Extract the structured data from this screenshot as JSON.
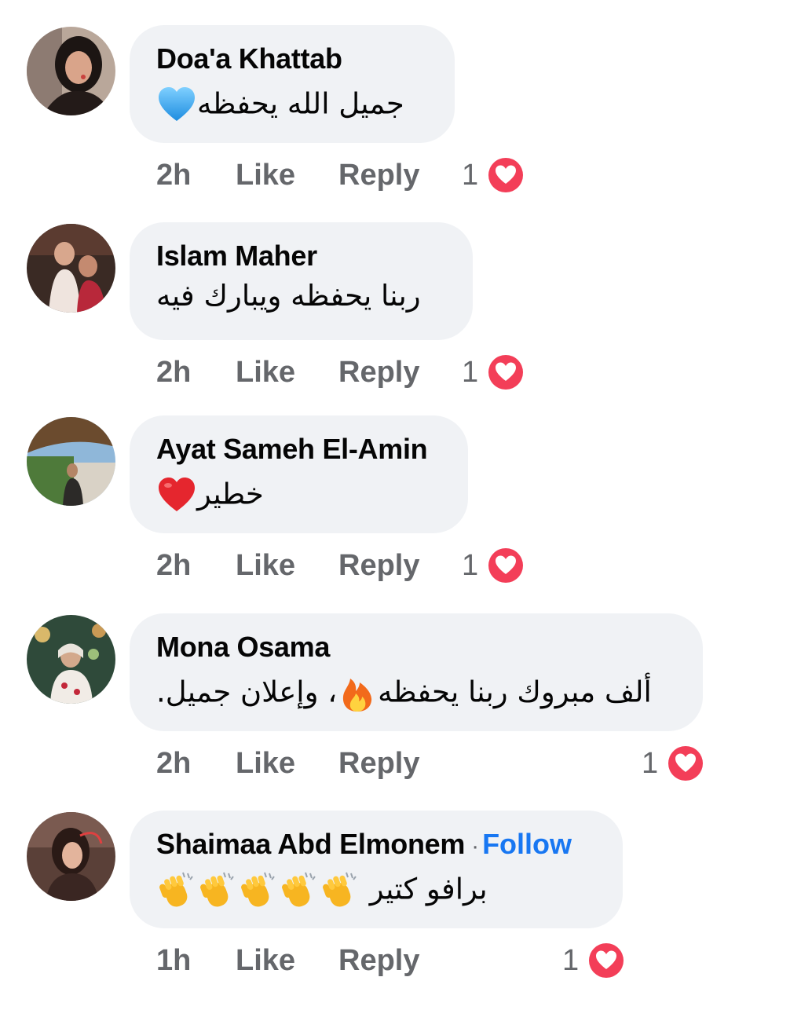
{
  "comments": [
    {
      "author": "Doa'a Khattab",
      "text": "جميل الله يحفظه",
      "emoji": "blue-heart-emoji",
      "time": "2h",
      "like_label": "Like",
      "reply_label": "Reply",
      "reaction_count": "1",
      "reaction_icon": "love-reaction-icon"
    },
    {
      "author": "Islam Maher",
      "text": "ربنا يحفظه ويبارك فيه",
      "time": "2h",
      "like_label": "Like",
      "reply_label": "Reply",
      "reaction_count": "1",
      "reaction_icon": "love-reaction-icon"
    },
    {
      "author": "Ayat Sameh El-Amin",
      "text": "خطير",
      "emoji": "red-heart-emoji",
      "time": "2h",
      "like_label": "Like",
      "reply_label": "Reply",
      "reaction_count": "1",
      "reaction_icon": "love-reaction-icon"
    },
    {
      "author": "Mona Osama",
      "text_before": "ألف مبروك ربنا يحفظه",
      "text_after": "، وإعلان جميل.",
      "emoji": "fire-emoji",
      "time": "2h",
      "like_label": "Like",
      "reply_label": "Reply",
      "reaction_count": "1",
      "reaction_icon": "love-reaction-icon"
    },
    {
      "author": "Shaimaa Abd Elmonem",
      "separator": "·",
      "follow_label": "Follow",
      "text": "برافو كتير",
      "emoji": "clapping-hands-emoji",
      "emoji_count": 5,
      "time": "1h",
      "like_label": "Like",
      "reply_label": "Reply",
      "reaction_count": "1",
      "reaction_icon": "love-reaction-icon"
    }
  ],
  "colors": {
    "bubble_bg": "#f0f2f5",
    "meta_text": "#65676b",
    "follow_link": "#1877f2",
    "love_reaction": "#f33e58"
  }
}
